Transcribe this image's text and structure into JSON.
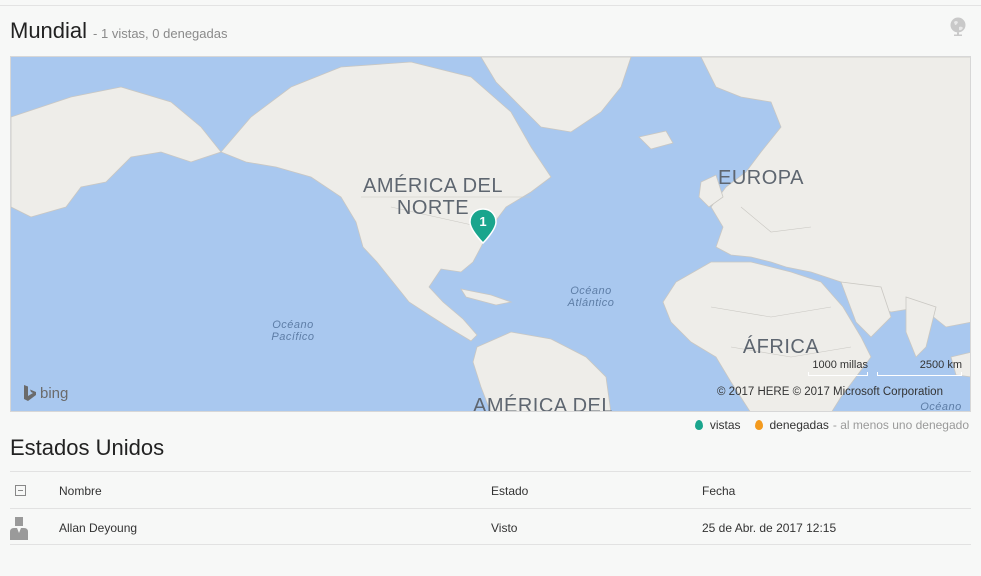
{
  "header": {
    "title": "Mundial",
    "subtitle": "- 1 vistas, 0 denegadas",
    "globe_icon": "globe-icon"
  },
  "map": {
    "labels": {
      "north_america": "AMÉRICA DEL NORTE",
      "europe": "EUROPA",
      "africa": "ÁFRICA",
      "south_america": "AMÉRICA DEL",
      "atlantic": "Océano Atlántico",
      "pacific": "Océano Pacífico",
      "ocean_bottom": "Océano"
    },
    "pin_count": "1",
    "provider": "bing",
    "scale_miles": "1000 millas",
    "scale_km": "2500 km",
    "copyright": "© 2017 HERE   © 2017 Microsoft Corporation",
    "pin_color": "#1aa58d"
  },
  "legend": {
    "viewed": "vistas",
    "denied": "denegadas",
    "note": "- al menos uno denegado",
    "viewed_color": "#1aa58d",
    "denied_color": "#f39a1e"
  },
  "section": {
    "title": "Estados Unidos"
  },
  "table": {
    "columns": [
      "Nombre",
      "Estado",
      "Fecha"
    ],
    "rows": [
      {
        "name": "Allan Deyoung",
        "state": "Visto",
        "date": "25 de Abr. de 2017 12:15"
      }
    ]
  }
}
